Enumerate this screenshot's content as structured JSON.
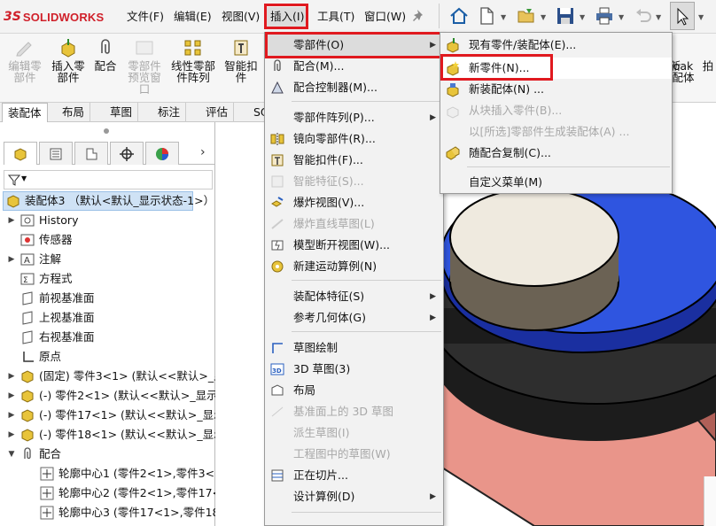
{
  "app": {
    "brand": "SOLIDWORKS",
    "brand_prefix": "3S"
  },
  "menubar": {
    "file": "文件(F)",
    "edit": "编辑(E)",
    "view": "视图(V)",
    "insert": "插入(I)",
    "tools": "工具(T)",
    "window": "窗口(W)"
  },
  "commands": [
    {
      "label": "编辑零\n部件",
      "enabled": false
    },
    {
      "label": "插入零\n部件",
      "enabled": true
    },
    {
      "label": "配合",
      "enabled": true
    },
    {
      "label": "零部件\n预览窗\n口",
      "enabled": false
    },
    {
      "label": "线性零部\n件阵列",
      "enabled": true
    },
    {
      "label": "智能扣\n件",
      "enabled": true
    }
  ],
  "commands_right": {
    "label1": "新",
    "label2": "oak\n配体",
    "label3": "拍"
  },
  "tabs": [
    "装配体",
    "布局",
    "草图",
    "标注",
    "评估",
    "SO"
  ],
  "tree": {
    "root": "装配体3 （默认<默认_显示状态-1>）",
    "items": [
      {
        "label": "History",
        "exp": "▶"
      },
      {
        "label": "传感器",
        "exp": ""
      },
      {
        "label": "注解",
        "exp": "▶"
      },
      {
        "label": "方程式",
        "exp": ""
      },
      {
        "label": "前视基准面",
        "exp": ""
      },
      {
        "label": "上视基准面",
        "exp": ""
      },
      {
        "label": "右视基准面",
        "exp": ""
      },
      {
        "label": "原点",
        "exp": ""
      },
      {
        "label": "(固定) 零件3<1> (默认<<默认>_显",
        "exp": "▶"
      },
      {
        "label": "(-) 零件2<1> (默认<<默认>_显示状",
        "exp": "▶"
      },
      {
        "label": "(-) 零件17<1> (默认<<默认>_显示",
        "exp": "▶"
      },
      {
        "label": "(-) 零件18<1> (默认<<默认>_显示",
        "exp": "▶"
      },
      {
        "label": "配合",
        "exp": "▼"
      },
      {
        "label": "轮廓中心1 (零件2<1>,零件3<1",
        "exp": ""
      },
      {
        "label": "轮廓中心2 (零件2<1>,零件17<",
        "exp": ""
      },
      {
        "label": "轮廓中心3 (零件17<1>,零件18",
        "exp": ""
      }
    ]
  },
  "insert_menu": {
    "items": [
      {
        "label": "零部件(O)",
        "enabled": true,
        "sub": true
      },
      {
        "label": "配合(M)...",
        "enabled": true,
        "sub": false
      },
      {
        "label": "配合控制器(M)...",
        "enabled": true,
        "sub": false
      },
      {
        "label": "零部件阵列(P)...",
        "enabled": true,
        "sub": true
      },
      {
        "label": "镜向零部件(R)...",
        "enabled": true,
        "sub": false
      },
      {
        "label": "智能扣件(F)...",
        "enabled": true,
        "sub": false
      },
      {
        "label": "智能特征(S)...",
        "enabled": false,
        "sub": false
      },
      {
        "label": "爆炸视图(V)...",
        "enabled": true,
        "sub": false
      },
      {
        "label": "爆炸直线草图(L)",
        "enabled": false,
        "sub": false
      },
      {
        "label": "模型断开视图(W)...",
        "enabled": true,
        "sub": false
      },
      {
        "label": "新建运动算例(N)",
        "enabled": true,
        "sub": false
      },
      {
        "label": "装配体特征(S)",
        "enabled": true,
        "sub": true
      },
      {
        "label": "参考几何体(G)",
        "enabled": true,
        "sub": true
      },
      {
        "label": "草图绘制",
        "enabled": true,
        "sub": false
      },
      {
        "label": "3D 草图(3)",
        "enabled": true,
        "sub": false
      },
      {
        "label": "布局",
        "enabled": true,
        "sub": false
      },
      {
        "label": "基准面上的 3D 草图",
        "enabled": false,
        "sub": false
      },
      {
        "label": "派生草图(I)",
        "enabled": false,
        "sub": false
      },
      {
        "label": "工程图中的草图(W)",
        "enabled": false,
        "sub": false
      },
      {
        "label": "正在切片...",
        "enabled": true,
        "sub": false
      },
      {
        "label": "设计算例(D)",
        "enabled": true,
        "sub": true
      }
    ]
  },
  "component_menu": {
    "items": [
      {
        "label": "现有零件/装配体(E)...",
        "enabled": true
      },
      {
        "label": "新零件(N)...",
        "enabled": true
      },
      {
        "label": "新装配体(N) ...",
        "enabled": true
      },
      {
        "label": "从块插入零件(B)...",
        "enabled": false
      },
      {
        "label": "以[所选]零部件生成装配体(A) ...",
        "enabled": false
      },
      {
        "label": "随配合复制(C)...",
        "enabled": true
      },
      {
        "label": "自定义菜单(M)",
        "enabled": true
      }
    ]
  },
  "colors": {
    "highlight_box": "#e0191f",
    "brand": "#d0202a"
  }
}
